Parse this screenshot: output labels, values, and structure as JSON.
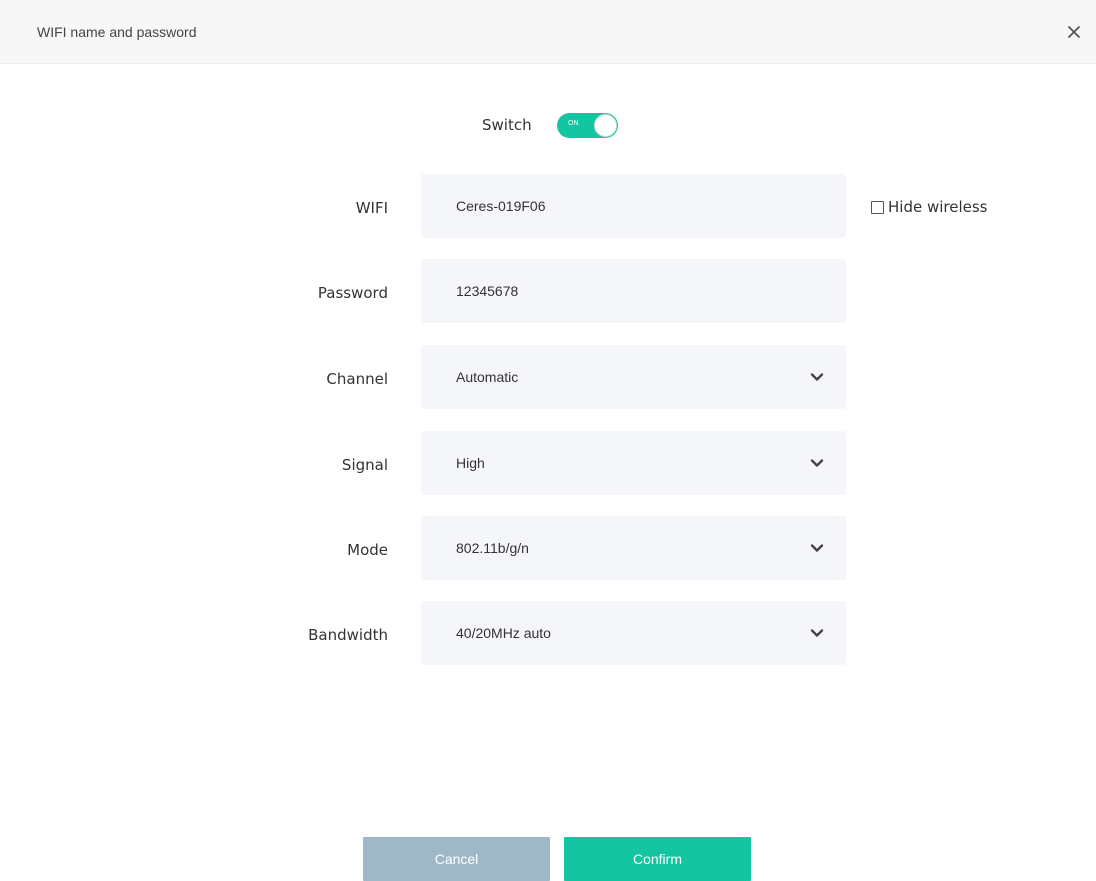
{
  "header": {
    "title": "WIFI name and password",
    "close_icon": "close-icon"
  },
  "switch": {
    "label": "Switch",
    "state_text": "ON",
    "on": true,
    "color": "#13c6a1"
  },
  "form": {
    "wifi": {
      "label": "WIFI",
      "value": "Ceres-019F06"
    },
    "hide_wireless": {
      "label": "Hide wireless",
      "checked": false
    },
    "password": {
      "label": "Password",
      "value": "12345678"
    },
    "channel": {
      "label": "Channel",
      "value": "Automatic",
      "icon": "chevron-down-icon"
    },
    "signal": {
      "label": "Signal",
      "value": "High",
      "icon": "chevron-down-icon"
    },
    "mode": {
      "label": "Mode",
      "value": "802.11b/g/n",
      "icon": "chevron-down-icon"
    },
    "bandwidth": {
      "label": "Bandwidth",
      "value": "40/20MHz auto",
      "icon": "chevron-down-icon"
    }
  },
  "buttons": {
    "cancel": {
      "label": "Cancel",
      "color": "#9fb8c8"
    },
    "confirm": {
      "label": "Confirm",
      "color": "#13c6a1"
    }
  }
}
